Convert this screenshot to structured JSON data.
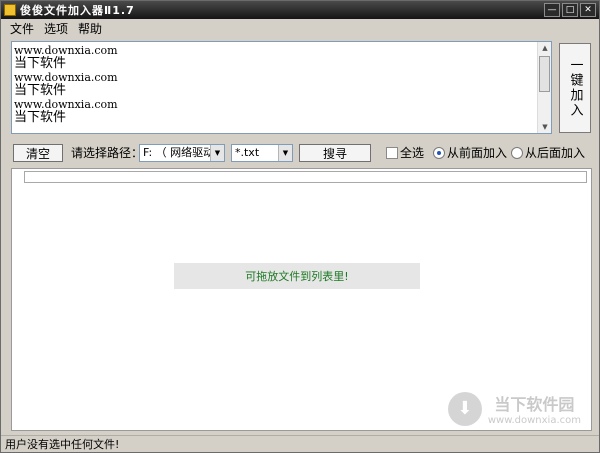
{
  "window": {
    "title": "俊俊文件加入器Ⅱ1.7"
  },
  "window_controls": {
    "minimize": "—",
    "maximize": "□",
    "close": "✕"
  },
  "menu": [
    {
      "label": "文件"
    },
    {
      "label": "选项"
    },
    {
      "label": "帮助"
    }
  ],
  "text_editor": {
    "lines": [
      "www.downxia.com",
      "当下软件",
      "www.downxia.com",
      "当下软件",
      "www.downxia.com",
      "当下软件"
    ]
  },
  "add_button": {
    "label": "一键加入"
  },
  "toolbar": {
    "clear_label": "清空",
    "path_label": "请选择路径：",
    "path_value": "F: （ 网络驱动",
    "filter_value": "*.txt",
    "search_label": "搜寻",
    "select_all_label": "全选",
    "insert_front_label": "从前面加入",
    "insert_back_label": "从后面加入",
    "select_all_checked": false,
    "insert_mode": "front"
  },
  "list": {
    "drop_hint": "可拖放文件到列表里!"
  },
  "watermark": {
    "title": "当下软件园",
    "url": "www.downxia.com"
  },
  "status": {
    "text": "用户没有选中任何文件!"
  },
  "icons": {
    "combo_arrow": "▼",
    "scroll_up": "▲",
    "scroll_down": "▼",
    "watermark": "⬇"
  }
}
